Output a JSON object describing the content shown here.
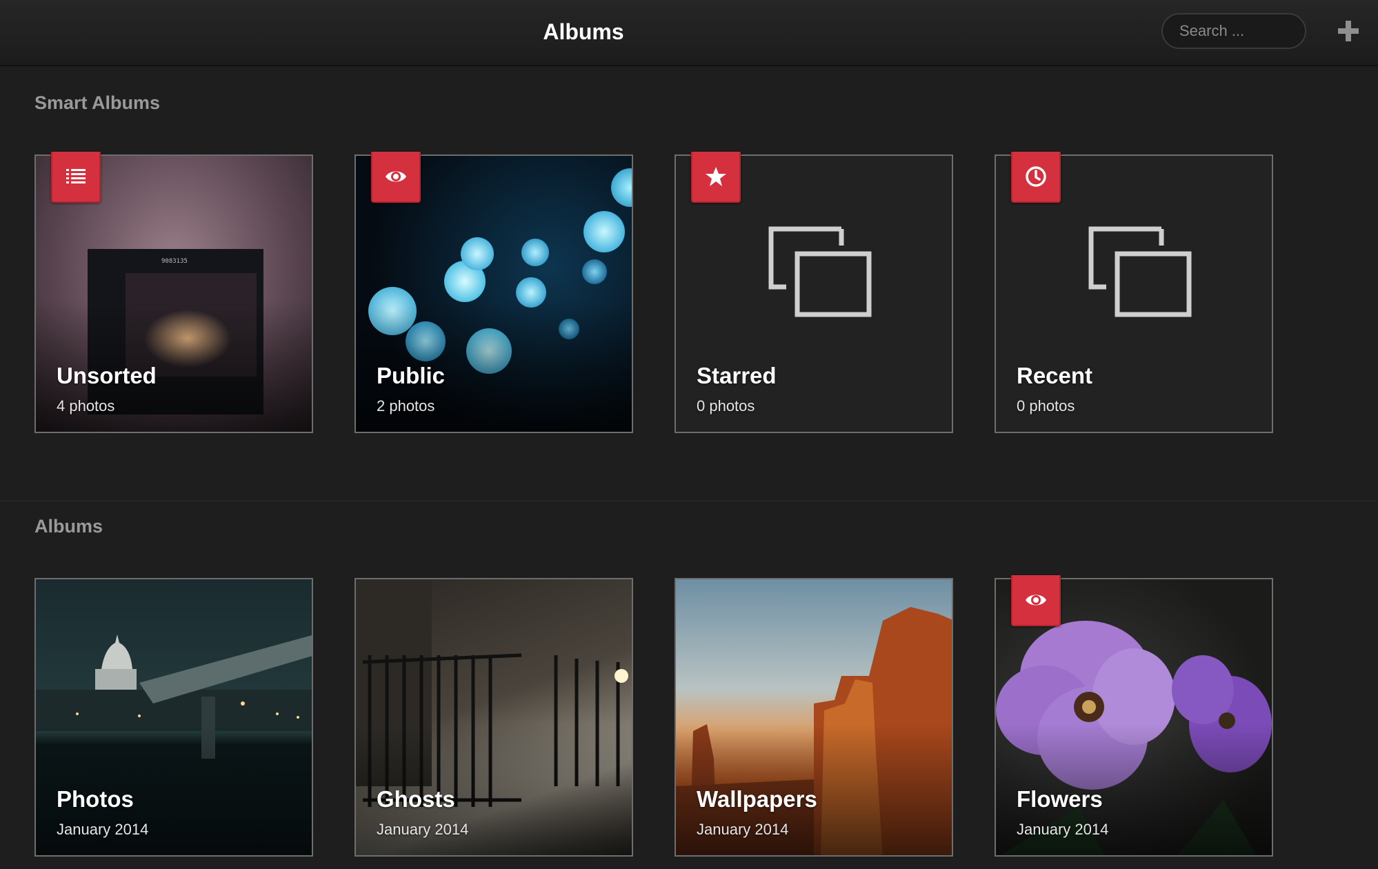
{
  "header": {
    "title": "Albums",
    "search_placeholder": "Search ...",
    "add_icon": "plus-icon"
  },
  "smart_albums": {
    "title": "Smart Albums",
    "items": [
      {
        "name": "Unsorted",
        "subtitle": "4 photos",
        "badge_icon": "list-icon"
      },
      {
        "name": "Public",
        "subtitle": "2 photos",
        "badge_icon": "eye-icon"
      },
      {
        "name": "Starred",
        "subtitle": "0 photos",
        "badge_icon": "star-icon"
      },
      {
        "name": "Recent",
        "subtitle": "0 photos",
        "badge_icon": "clock-icon"
      }
    ],
    "camera_label": "9083135"
  },
  "albums": {
    "title": "Albums",
    "items": [
      {
        "name": "Photos",
        "subtitle": "January 2014"
      },
      {
        "name": "Ghosts",
        "subtitle": "January 2014"
      },
      {
        "name": "Wallpapers",
        "subtitle": "January 2014"
      },
      {
        "name": "Flowers",
        "subtitle": "January 2014",
        "badge_icon": "eye-icon"
      }
    ]
  },
  "colors": {
    "badge": "#d5303d",
    "background": "#1e1e1e",
    "section_title": "#9a9a9a"
  }
}
